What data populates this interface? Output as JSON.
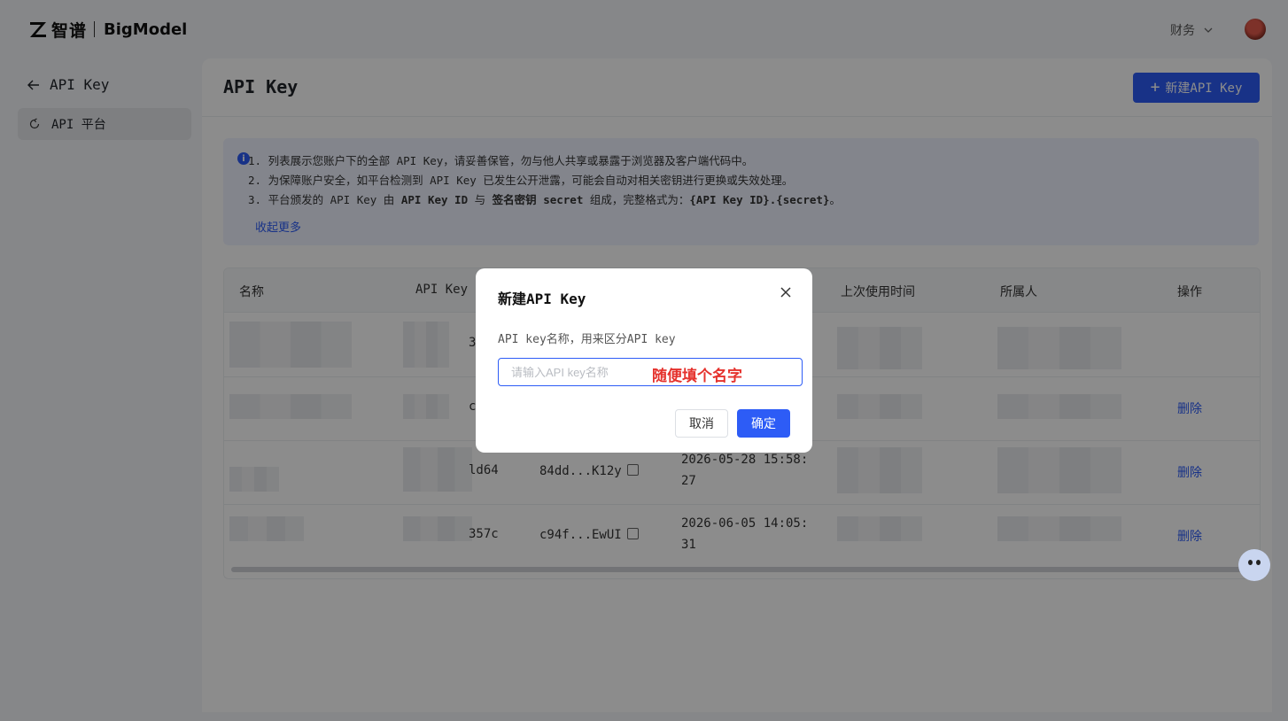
{
  "header": {
    "logo_cn": "智谱",
    "logo_en": "BigModel",
    "finance_label": "财务"
  },
  "sidebar": {
    "back_label": "API Key",
    "items": [
      {
        "label": "API 平台"
      }
    ]
  },
  "main": {
    "title": "API Key",
    "new_button_label": "新建API Key",
    "notice": {
      "line1": "1. 列表展示您账户下的全部 API Key，请妥善保管，勿与他人共享或暴露于浏览器及客户端代码中。",
      "line2": "2. 为保障账户安全，如平台检测到 API Key 已发生公开泄露，可能会自动对相关密钥进行更换或失效处理。",
      "line3_a": "3. 平台颁发的 API Key 由 ",
      "line3_b": "API Key ID",
      "line3_c": " 与 ",
      "line3_d": "签名密钥 secret",
      "line3_e": " 组成，完整格式为：",
      "line3_f": "{API Key ID}.{secret}",
      "line3_g": "。",
      "collapse_label": "收起更多"
    },
    "table": {
      "columns": [
        "名称",
        "API Key",
        "上次使用时间",
        "所属人",
        "操作"
      ],
      "rows": [
        {
          "key_tail": "3",
          "secret": "",
          "created": "",
          "action": ""
        },
        {
          "key_tail": "c",
          "secret": "",
          "created": "",
          "action": "删除"
        },
        {
          "key_tail": "ld64",
          "secret": "84dd...K12y",
          "created_1": "2026-05-28 15:58:",
          "created_2": "27",
          "action": "删除"
        },
        {
          "key_tail": "357c",
          "secret": "c94f...EwUI",
          "created_1": "2026-06-05 14:05:",
          "created_2": "31",
          "action": "删除"
        }
      ]
    }
  },
  "modal": {
    "title": "新建API Key",
    "field_label": "API key名称，用来区分API key",
    "input_value": "",
    "input_placeholder": "请输入API key名称",
    "annotation": "随便填个名字",
    "cancel_label": "取消",
    "ok_label": "确定"
  },
  "colors": {
    "primary": "#2d5cf6",
    "annotation": "#e5322d"
  }
}
